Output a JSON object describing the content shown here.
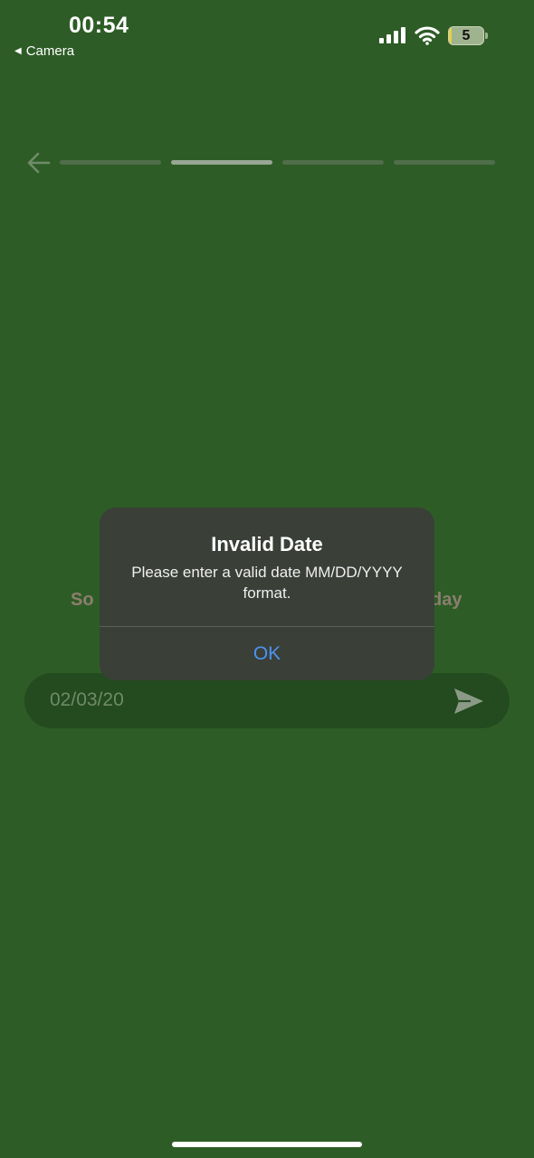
{
  "status_bar": {
    "time": "00:54",
    "back_label": "Camera",
    "back_glyph": "◀",
    "battery_level": "5"
  },
  "progress": {
    "total_steps": 4,
    "current_step": 2
  },
  "question": {
    "visible_left": "So",
    "visible_right": "day"
  },
  "input": {
    "value": "02/03/20"
  },
  "alert": {
    "title": "Invalid Date",
    "message": "Please enter a valid date MM/DD/YYYY format.",
    "ok_label": "OK"
  },
  "colors": {
    "background": "#2e5c26",
    "alert_background": "#3a3f38",
    "ok_button": "#4d93ef",
    "input_background": "#244a1f"
  },
  "icons": {
    "back": "arrow-left-icon",
    "send": "send-icon",
    "signal": "cellular-signal-icon",
    "wifi": "wifi-icon",
    "battery": "battery-icon"
  }
}
